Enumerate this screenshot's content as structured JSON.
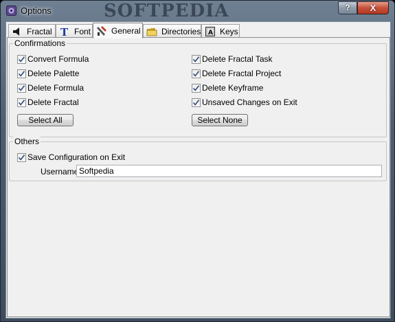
{
  "window": {
    "title": "Options",
    "watermark": "SOFTPEDIA",
    "help_label": "?",
    "close_label": "X"
  },
  "tabs": [
    {
      "label": "Fractal",
      "icon": "speaker-icon",
      "active": false
    },
    {
      "label": "Font",
      "icon": "font-t-icon",
      "active": false
    },
    {
      "label": "General",
      "icon": "tools-icon",
      "active": true
    },
    {
      "label": "Directories",
      "icon": "folder-icon",
      "active": false
    },
    {
      "label": "Keys",
      "icon": "key-a-icon",
      "active": false
    }
  ],
  "confirmations": {
    "legend": "Confirmations",
    "left": [
      {
        "label": "Convert Formula",
        "checked": true
      },
      {
        "label": "Delete Palette",
        "checked": true
      },
      {
        "label": "Delete Formula",
        "checked": true
      },
      {
        "label": "Delete Fractal",
        "checked": true
      }
    ],
    "right": [
      {
        "label": "Delete Fractal Task",
        "checked": true
      },
      {
        "label": "Delete Fractal Project",
        "checked": true
      },
      {
        "label": "Delete Keyframe",
        "checked": true
      },
      {
        "label": "Unsaved Changes on Exit",
        "checked": true
      }
    ],
    "select_all_label": "Select All",
    "select_none_label": "Select None"
  },
  "others": {
    "legend": "Others",
    "save_config": {
      "label": "Save Configuration on Exit",
      "checked": true
    },
    "username_label": "Username",
    "username_value": "Softpedia"
  }
}
